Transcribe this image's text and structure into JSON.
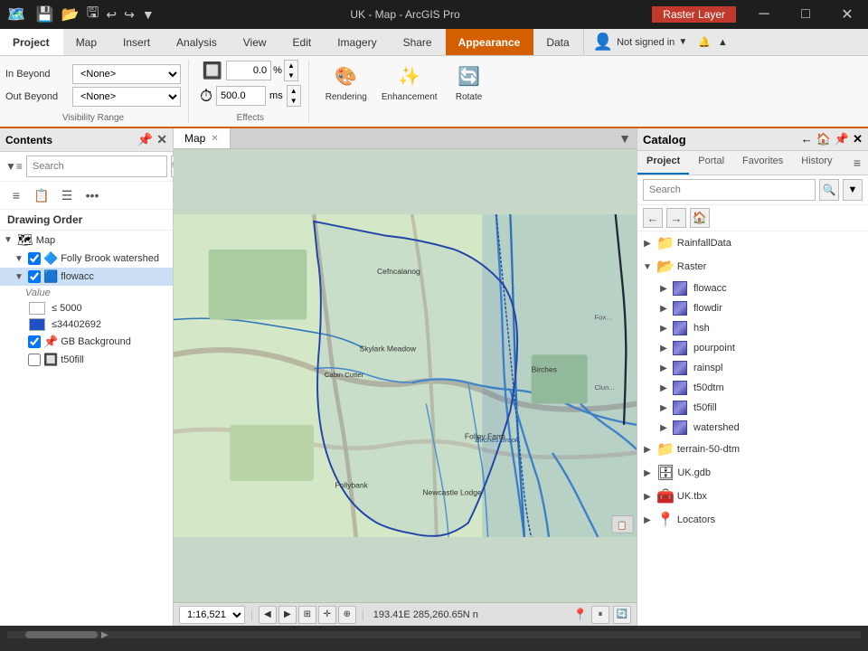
{
  "titleBar": {
    "title": "UK - Map - ArcGIS Pro",
    "rasterLayer": "Raster Layer",
    "minBtn": "─",
    "maxBtn": "□",
    "closeBtn": "✕"
  },
  "ribbonTabs": {
    "project": "Project",
    "map": "Map",
    "insert": "Insert",
    "analysis": "Analysis",
    "view": "View",
    "edit": "Edit",
    "imagery": "Imagery",
    "share": "Share",
    "appearance": "Appearance",
    "data": "Data",
    "help": "?"
  },
  "notSignedIn": {
    "label": "Not signed in",
    "bell": "🔔",
    "expand": "▼"
  },
  "ribbon": {
    "inBeyond": {
      "label": "In Beyond",
      "value": "<None>"
    },
    "outBeyond": {
      "label": "Out Beyond",
      "value": "<None>"
    },
    "visibilityRangeLabel": "Visibility Range",
    "percentValue": "0.0",
    "percentUnit": "%",
    "msValue": "500.0",
    "msUnit": "ms",
    "effectsLabel": "Effects",
    "renderingBtn": "Rendering",
    "enhancementBtn": "Enhancement",
    "rotateBtn": "Rotate"
  },
  "contentsPanel": {
    "title": "Contents",
    "searchPlaceholder": "Search",
    "drawingOrderLabel": "Drawing Order",
    "layers": {
      "map": "Map",
      "follyBrookWatershed": "Folly Brook watershed",
      "flowacc": "flowacc",
      "value": "Value",
      "lessThan5000": "≤ 5000",
      "lessThan34402692": "≤34402692",
      "gbBackground": "GB Background",
      "t50fill": "t50fill"
    }
  },
  "mapTab": {
    "label": "Map"
  },
  "mapScale": "1:16,521",
  "statusCoords": "193.41E 285,260.65N n",
  "catalogPanel": {
    "title": "Catalog",
    "tabs": [
      "Project",
      "Portal",
      "Favorites",
      "History"
    ],
    "activeTab": "Project",
    "searchPlaceholder": "Search",
    "items": {
      "rainfallData": "RainfallData",
      "raster": "Raster",
      "flowacc": "flowacc",
      "flowdir": "flowdir",
      "hsh": "hsh",
      "pourpoint": "pourpoint",
      "rainspl": "rainspl",
      "t50dtm": "t50dtm",
      "t50fill": "t50fill",
      "watershed": "watershed",
      "terrain50dtm": "terrain-50-dtm",
      "ukGdb": "UK.gdb",
      "ukTbx": "UK.tbx",
      "locators": "Locators"
    }
  },
  "mapPlace": {
    "labels": [
      "Cefncalanog",
      "Birches Brook",
      "Skylark Meadow",
      "Cabin Cutter",
      "Birches",
      "Folley Farm",
      "Follybank",
      "Newcastle Lodge"
    ]
  },
  "bottomBar": {
    "text": ""
  }
}
